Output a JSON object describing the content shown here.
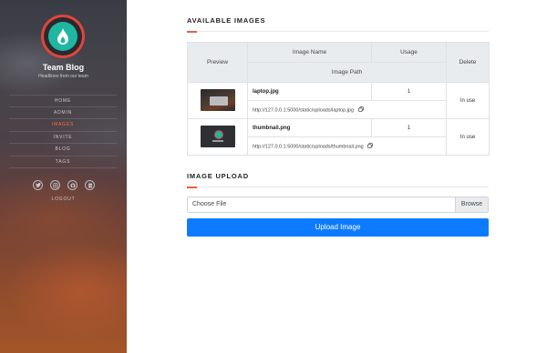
{
  "sidebar": {
    "brand": "Team Blog",
    "tagline": "Headlines from our team",
    "nav": [
      {
        "label": "HOME",
        "active": false
      },
      {
        "label": "ADMIN",
        "active": false
      },
      {
        "label": "IMAGES",
        "active": true
      },
      {
        "label": "INVITE",
        "active": false
      },
      {
        "label": "BLOG",
        "active": false
      },
      {
        "label": "TAGS",
        "active": false
      }
    ],
    "social_icons": [
      "twitter-icon",
      "instagram-icon",
      "github-icon",
      "database-icon"
    ],
    "logout": "LOGOUT",
    "colors": {
      "accent": "#ff6a3d",
      "logo_teal": "#1fb6a2",
      "logo_ring": "#e1453c"
    }
  },
  "images_section": {
    "title": "AVAILABLE IMAGES",
    "columns": {
      "preview": "Preview",
      "image_name": "Image Name",
      "usage": "Usage",
      "delete": "Delete",
      "image_path": "Image Path"
    },
    "rows": [
      {
        "name": "laptop.jpg",
        "usage": "1",
        "status": "In use",
        "path": "http://127.0.0.1:5000/static/uploads/laptop.jpg"
      },
      {
        "name": "thumbnail.png",
        "usage": "1",
        "status": "In use",
        "path": "http://127.0.0.1:5000/static/uploads/thumbnail.png"
      }
    ]
  },
  "upload_section": {
    "title": "IMAGE UPLOAD",
    "file_label": "Choose File",
    "browse_label": "Browse",
    "button_label": "Upload Image",
    "button_color": "#0d7bff"
  }
}
